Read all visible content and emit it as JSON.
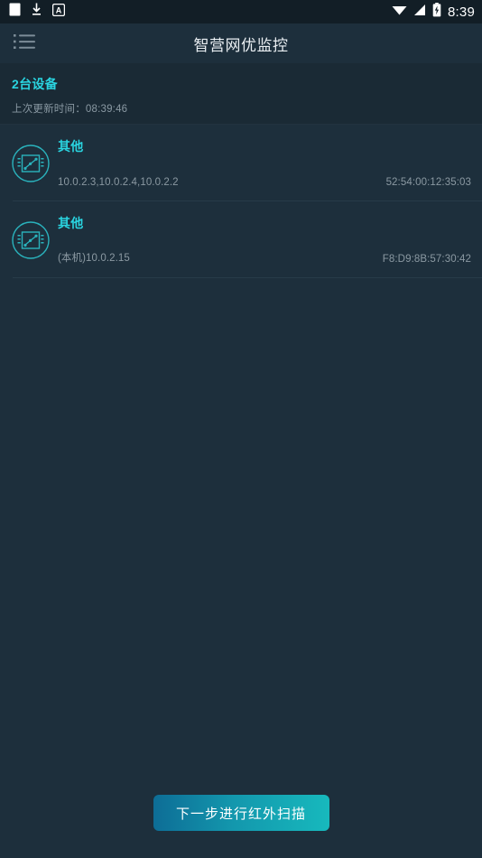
{
  "status_bar": {
    "icons": [
      "notification-square-icon",
      "download-icon",
      "letter-a-box-icon"
    ],
    "wifi_icon": "wifi-icon",
    "signal_icon": "signal-icon",
    "battery_icon": "battery-charging-icon",
    "clock": "8:39"
  },
  "title_bar": {
    "menu_icon": "list-menu-icon",
    "title": "智营网优监控"
  },
  "summary": {
    "count_label": "2台设备",
    "updated_label": "上次更新时间：08:39:46"
  },
  "devices": [
    {
      "icon": "device-chip-icon",
      "name": "其他",
      "ip": "10.0.2.3,10.0.2.4,10.0.2.2",
      "mac": "52:54:00:12:35:03"
    },
    {
      "icon": "device-chip-icon",
      "name": "其他",
      "ip": "(本机)10.0.2.15",
      "mac": "F8:D9:8B:57:30:42"
    }
  ],
  "footer": {
    "scan_button_label": "下一步进行红外扫描"
  },
  "colors": {
    "accent_cyan": "#2ad4e0",
    "background": "#1d2f3c",
    "summary_background": "#1a2a35",
    "status_bar_background": "#121e26",
    "muted_text": "#8b99a2",
    "button_gradient_start": "#0d6d96",
    "button_gradient_end": "#17b9bd"
  }
}
